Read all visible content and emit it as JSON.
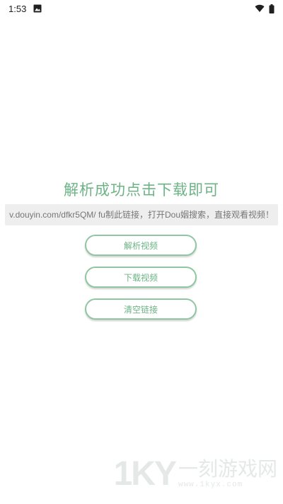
{
  "status_bar": {
    "time": "1:53",
    "left_icon": "image-icon",
    "right_icons": [
      "wifi-icon",
      "battery-icon"
    ]
  },
  "main": {
    "title": "解析成功点击下载即可",
    "link_text": "v.douyin.com/dfkr5QM/ fu制此链接，打开Dou姻搜索，直接观看视频！",
    "buttons": {
      "parse": "解析视频",
      "download": "下载视频",
      "clear": "清空链接"
    }
  },
  "watermark": {
    "logo": "1KY",
    "name": "一刻游戏网",
    "url": "www.1kyx.com"
  },
  "colors": {
    "accent": "#6db386",
    "button_border": "#8fc7a3",
    "input_bg": "#eeeeee"
  }
}
